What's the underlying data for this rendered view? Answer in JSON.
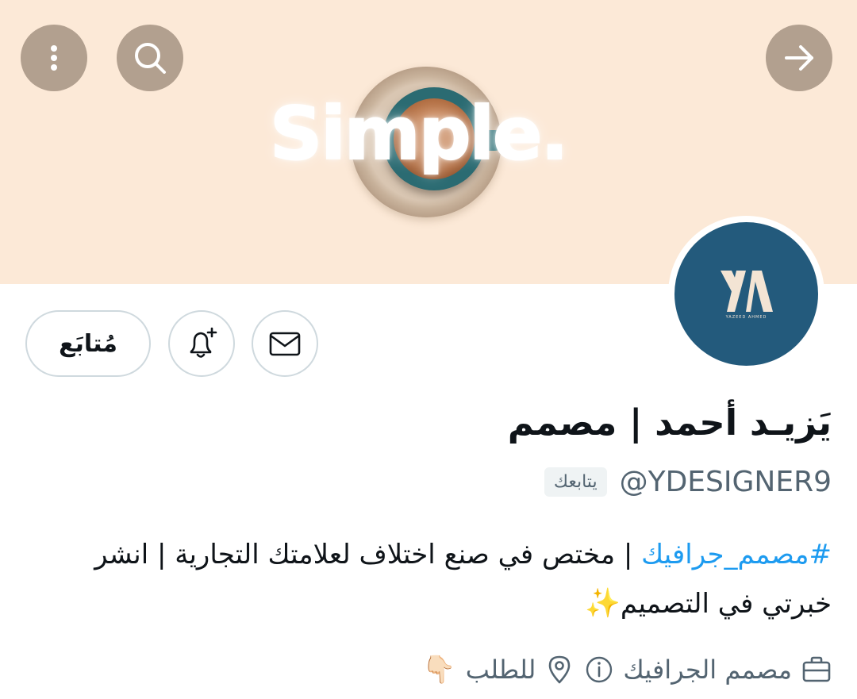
{
  "banner": {
    "headline": "Simple."
  },
  "header_buttons": {
    "more_icon": "more-vertical-icon",
    "search_icon": "search-icon",
    "forward_icon": "arrow-right-icon"
  },
  "avatar": {
    "brand": "YAZEED AHMED"
  },
  "actions": {
    "follow_label": "مُتابَع",
    "notify_icon": "bell-plus-icon",
    "message_icon": "mail-icon"
  },
  "profile": {
    "display_name": "يَزيـد أحمد | مصمم",
    "handle": "@YDESIGNER9",
    "follows_you": "يتابعك",
    "bio": {
      "hashtag": "#مصمم_جرافيك",
      "text_line1": " | مختص في صنع اختلاف لعلامتك التجارية | انشر",
      "text_line2": "خبرتي في التصميم",
      "sparkle": "✨"
    },
    "meta": {
      "category": "مصمم الجرافيك",
      "location": "للطلب",
      "location_emoji": "👇🏻"
    }
  },
  "colors": {
    "banner_bg": "#fce9d7",
    "avatar_bg": "#235a7c",
    "link": "#1d9bf0",
    "secondary_text": "#536471"
  }
}
